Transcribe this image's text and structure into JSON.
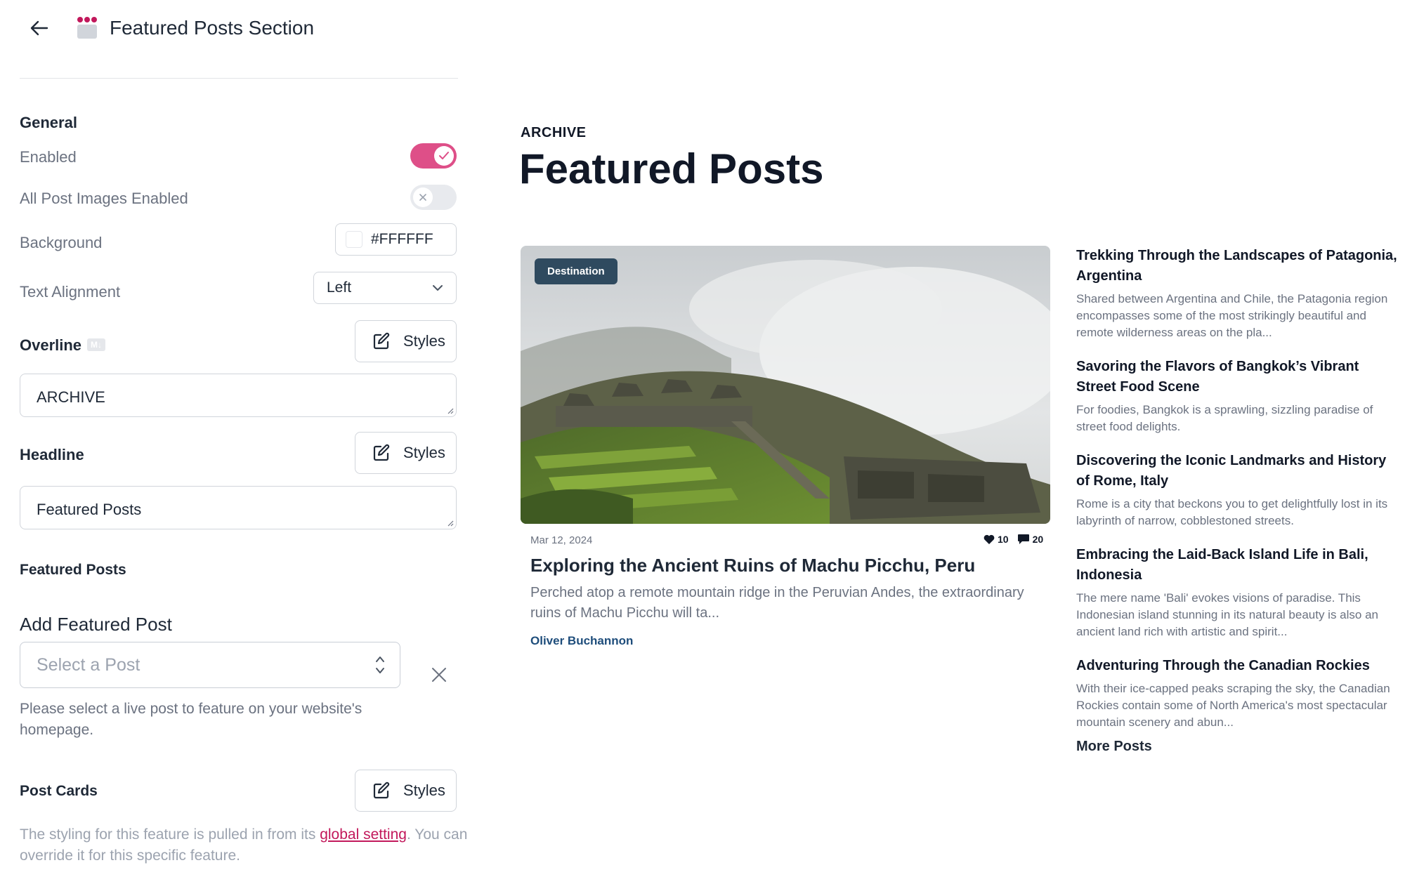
{
  "header": {
    "title": "Featured Posts Section"
  },
  "general": {
    "heading": "General",
    "enabled_label": "Enabled",
    "enabled": true,
    "all_images_label": "All Post Images Enabled",
    "all_images_enabled": false,
    "background_label": "Background",
    "background_value": "#FFFFFF",
    "alignment_label": "Text Alignment",
    "alignment_value": "Left"
  },
  "overline": {
    "label": "Overline",
    "badge": "M↓",
    "styles_label": "Styles",
    "value": "ARCHIVE"
  },
  "headline": {
    "label": "Headline",
    "styles_label": "Styles",
    "value": "Featured Posts"
  },
  "featured": {
    "heading": "Featured Posts",
    "add_title": "Add Featured Post",
    "select_placeholder": "Select a Post",
    "helper": "Please select a live post to feature on your website's homepage."
  },
  "post_cards": {
    "label": "Post Cards",
    "styles_label": "Styles",
    "note_prefix": "The styling for this feature is pulled in from its ",
    "note_link": "global setting",
    "note_suffix": ". You can override it for this specific feature."
  },
  "preview": {
    "overline": "ARCHIVE",
    "headline": "Featured Posts",
    "main_post": {
      "badge": "Destination",
      "date": "Mar 12, 2024",
      "likes": "10",
      "comments": "20",
      "title": "Exploring the Ancient Ruins of Machu Picchu, Peru",
      "excerpt": "Perched atop a remote mountain ridge in the Peruvian Andes, the extraordinary ruins of Machu Picchu will ta...",
      "author": "Oliver Buchannon"
    },
    "side_posts": [
      {
        "title": "Trekking Through the Landscapes of Patagonia, Argentina",
        "excerpt": "Shared between Argentina and Chile, the Patagonia region encompasses some of the most strikingly beautiful and remote wilderness areas on the pla..."
      },
      {
        "title": "Savoring the Flavors of Bangkok’s Vibrant Street Food Scene",
        "excerpt": "For foodies, Bangkok is a sprawling, sizzling paradise of street food delights."
      },
      {
        "title": "Discovering the Iconic Landmarks and History of Rome, Italy",
        "excerpt": "Rome is a city that beckons you to get delightfully lost in its labyrinth of narrow, cobblestoned streets."
      },
      {
        "title": "Embracing the Laid-Back Island Life in Bali, Indonesia",
        "excerpt": "The mere name 'Bali' evokes visions of paradise. This Indonesian island stunning in its natural beauty is also an ancient land rich with artistic and spirit..."
      },
      {
        "title": "Adventuring Through the Canadian Rockies",
        "excerpt": "With their ice-capped peaks scraping the sky, the Canadian Rockies contain some of North America's most spectacular mountain scenery and abun..."
      }
    ],
    "more_posts": "More Posts"
  },
  "colors": {
    "accent": "#de4f88",
    "badge_bg": "#2f4a5f",
    "author": "#1e4d7b",
    "link": "#c2185b"
  }
}
